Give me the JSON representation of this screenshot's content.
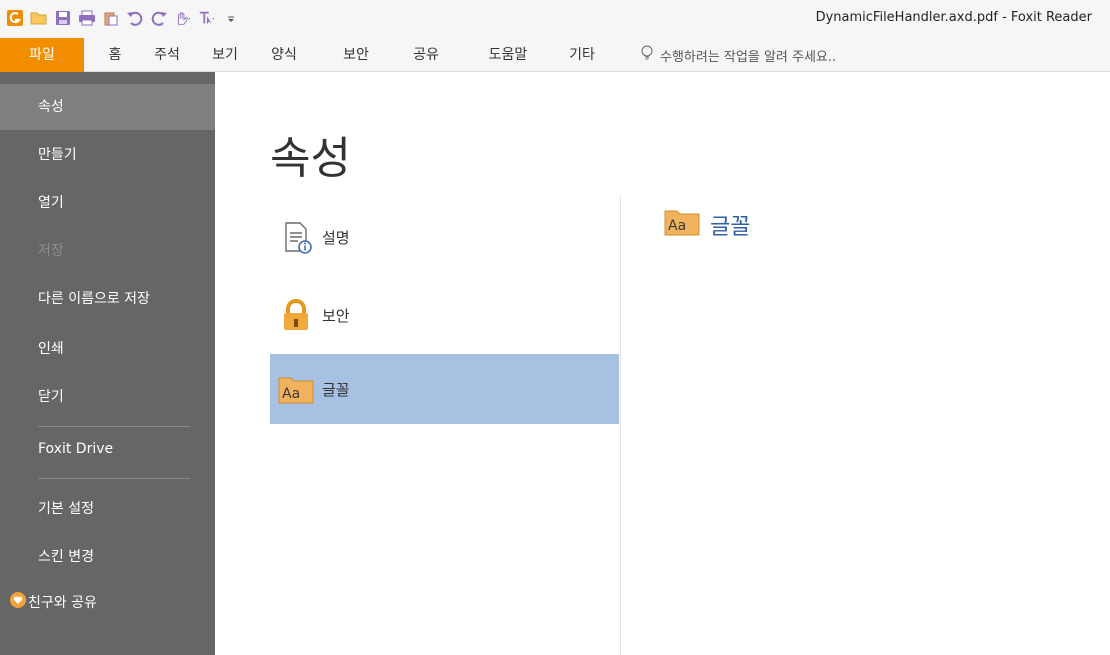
{
  "window": {
    "title": "DynamicFileHandler.axd.pdf - Foxit Reader"
  },
  "quick_access": {
    "icons": [
      "foxit-logo-icon",
      "open-folder-icon",
      "save-icon",
      "print-icon",
      "paste-icon",
      "undo-icon",
      "redo-icon",
      "hand-tool-icon",
      "select-text-icon",
      "customize-dropdown-icon"
    ]
  },
  "ribbon": {
    "tabs": [
      {
        "label": "파일",
        "active": true
      },
      {
        "label": "홈"
      },
      {
        "label": "주석"
      },
      {
        "label": "보기"
      },
      {
        "label": "양식"
      },
      {
        "label": "보안"
      },
      {
        "label": "공유"
      },
      {
        "label": "도움말"
      },
      {
        "label": "기타"
      }
    ],
    "tell_me": "수행하려는 작업을 알려 주세요.."
  },
  "file_menu": {
    "items": [
      {
        "label": "속성",
        "active": true
      },
      {
        "label": "만들기"
      },
      {
        "label": "열기"
      },
      {
        "label": "저장",
        "disabled": true
      },
      {
        "label": "다른 이름으로 저장"
      },
      {
        "label": "인쇄"
      },
      {
        "label": "닫기"
      },
      {
        "label": "Foxit Drive"
      },
      {
        "label": "기본 설정"
      },
      {
        "label": "스킨 변경"
      },
      {
        "label": "친구와 공유"
      }
    ]
  },
  "main": {
    "title": "속성",
    "properties": [
      {
        "label": "설명",
        "icon": "document-info-icon"
      },
      {
        "label": "보안",
        "icon": "lock-icon"
      },
      {
        "label": "글꼴",
        "icon": "font-folder-icon",
        "selected": true
      }
    ],
    "detail_title": "글꼴"
  },
  "colors": {
    "accent": "#f28d00",
    "nav_bg": "#666666",
    "nav_active": "#7f7f7f",
    "selection": "#a7c1e3",
    "link": "#2f5fa5"
  }
}
